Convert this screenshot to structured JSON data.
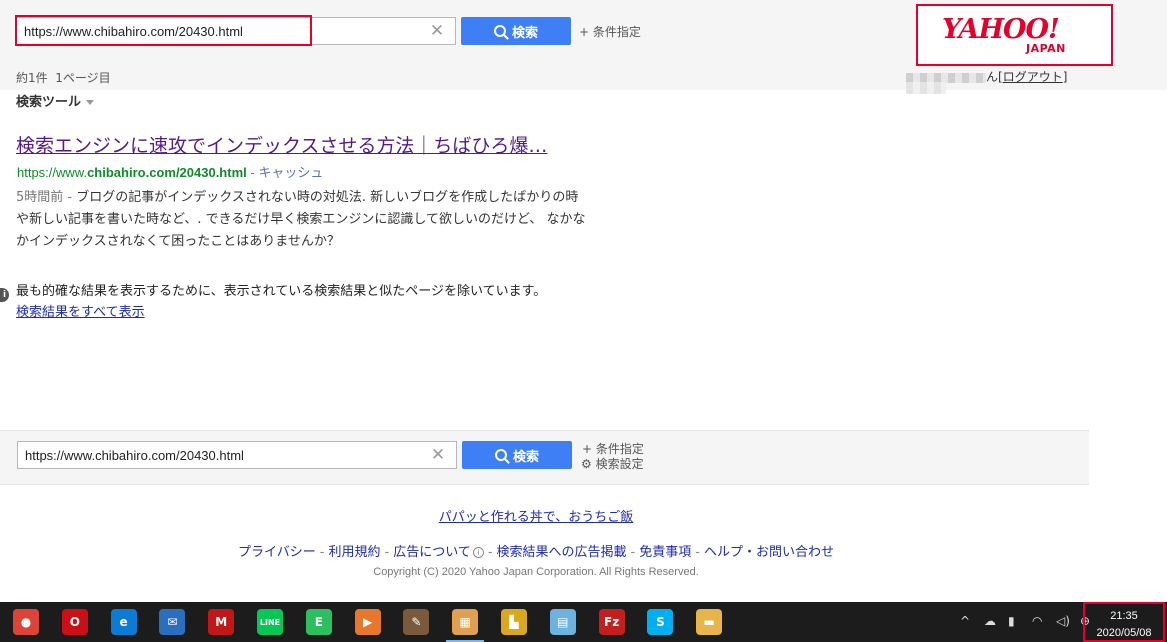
{
  "search": {
    "query": "https://www.chibahiro.com/20430.html",
    "button_label": "検索",
    "advanced_label": "条件指定",
    "settings_label": "検索設定"
  },
  "header": {
    "logo_main": "YAHOO!",
    "logo_sub": "JAPAN",
    "user_suffix": "ん[",
    "logout_label": "ログアウト",
    "user_close": "]"
  },
  "results_info": {
    "count": "約1件",
    "page": "1ページ目",
    "tools_label": "検索ツール"
  },
  "result": {
    "title": "検索エンジンに速攻でインデックスさせる方法｜ちばひろ爆…",
    "url_scheme": "https://www.",
    "url_domain": "chibahiro.com",
    "url_path": "/20430.html",
    "url_sep": " - ",
    "cache_label": "キャッシュ",
    "time": "5時間前",
    "time_sep": " - ",
    "snippet": "ブログの記事がインデックスされない時の対処法. 新しいブログを作成したばかりの時や新しい記事を書いた時など、. できるだけ早く検索エンジンに認識して欲しいのだけど、 なかなかインデックスされなくて困ったことはありませんか？"
  },
  "notice": {
    "text": "最も的確な結果を表示するために、表示されている検索結果と似たページを除いています。",
    "show_all": "検索結果をすべて表示"
  },
  "footer": {
    "promo": "パパッと作れる丼で、おうちご飯",
    "links": [
      "プライバシー",
      "利用規約",
      "広告について",
      "検索結果への広告掲載",
      "免責事項",
      "ヘルプ・お問い合わせ"
    ],
    "separator": "-",
    "copyright": "Copyright (C) 2020 Yahoo Japan Corporation. All Rights Reserved."
  },
  "taskbar": {
    "time": "21:35",
    "date": "2020/05/08",
    "apps": [
      {
        "name": "chrome",
        "glyph": "●",
        "color": "#db4437"
      },
      {
        "name": "opera",
        "glyph": "O",
        "color": "#cc0f16"
      },
      {
        "name": "edge",
        "glyph": "e",
        "color": "#0c7bd6"
      },
      {
        "name": "thunderbird",
        "glyph": "✉",
        "color": "#2a6fbd"
      },
      {
        "name": "mcafee",
        "glyph": "M",
        "color": "#c01818"
      },
      {
        "name": "line",
        "glyph": "LINE",
        "color": "#06c755"
      },
      {
        "name": "evernote",
        "glyph": "E",
        "color": "#2dbe60"
      },
      {
        "name": "media-player",
        "glyph": "▶",
        "color": "#e8772e"
      },
      {
        "name": "video-app",
        "glyph": "✎",
        "color": "#7a5a3a"
      },
      {
        "name": "paint-app",
        "glyph": "▦",
        "color": "#e0a050"
      },
      {
        "name": "user-folder",
        "glyph": "▙",
        "color": "#d9a81e"
      },
      {
        "name": "notepad-app",
        "glyph": "▤",
        "color": "#6db3e0"
      },
      {
        "name": "filezilla",
        "glyph": "Fz",
        "color": "#c41f1f"
      },
      {
        "name": "skype",
        "glyph": "S",
        "color": "#00aff0"
      },
      {
        "name": "file-explorer",
        "glyph": "▬",
        "color": "#e8b54a"
      }
    ],
    "tray": [
      "^",
      "☁",
      "▮",
      "◠",
      "◁)",
      "⊕"
    ]
  }
}
